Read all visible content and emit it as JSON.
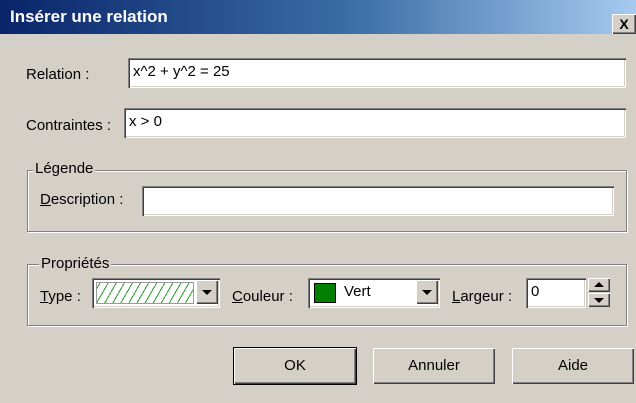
{
  "dialog": {
    "title": "Insérer une relation",
    "close_symbol": "X"
  },
  "relation": {
    "label": "Relation :",
    "value": "x^2 + y^2 = 25"
  },
  "constraints": {
    "label": "Contraintes :",
    "value": "x > 0"
  },
  "legend_group": {
    "title": "Légende",
    "description_label_first": "D",
    "description_label_rest": "escription :",
    "description_value": ""
  },
  "properties_group": {
    "title": "Propriétés",
    "type_label_first": "T",
    "type_label_rest": "ype :",
    "type_pattern_icon": "diagonal-hatch-pattern",
    "color_label_first": "C",
    "color_label_rest": "ouleur :",
    "color_value": "Vert",
    "color_swatch": "#008000",
    "width_label_first": "L",
    "width_label_rest": "argeur :",
    "width_value": "0"
  },
  "buttons": {
    "ok": "OK",
    "cancel": "Annuler",
    "help": "Aide"
  }
}
